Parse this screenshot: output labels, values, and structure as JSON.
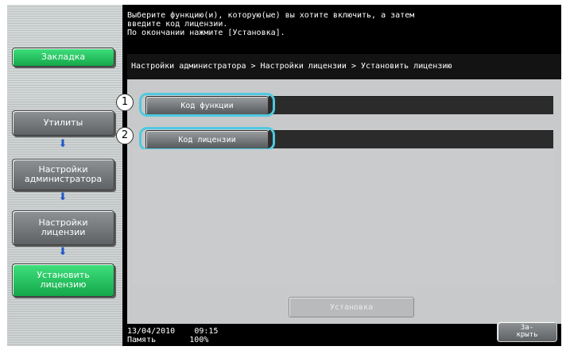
{
  "message": {
    "line1": "Выберите функцию(и), которую(ые) вы хотите включить, а затем",
    "line2": "введите код лицензии.",
    "line3": "По окончании нажмите [Установка]."
  },
  "sidebar": {
    "bookmark": "Закладка",
    "utilities": "Утилиты",
    "admin_line1": "Настройки",
    "admin_line2": "администратора",
    "license_line1": "Настройки",
    "license_line2": "лицензии",
    "install_line1": "Установить",
    "install_line2": "лицензию"
  },
  "breadcrumb": "Настройки администратора > Настройки лицензии > Установить лицензию",
  "fields": [
    {
      "callout": "1",
      "label": "Код функции",
      "value": ""
    },
    {
      "callout": "2",
      "label": "Код лицензии",
      "value": ""
    }
  ],
  "install_button": "Установка",
  "status": {
    "date": "13/04/2010",
    "time": "09:15",
    "memory_label": "Память",
    "memory_value": "100%"
  },
  "close_button": {
    "line1": "За-",
    "line2": "крыть"
  },
  "colors": {
    "accent_green": "#22c05a",
    "callout_ring": "#4fc9e0",
    "arrow_blue": "#1e58c8"
  }
}
